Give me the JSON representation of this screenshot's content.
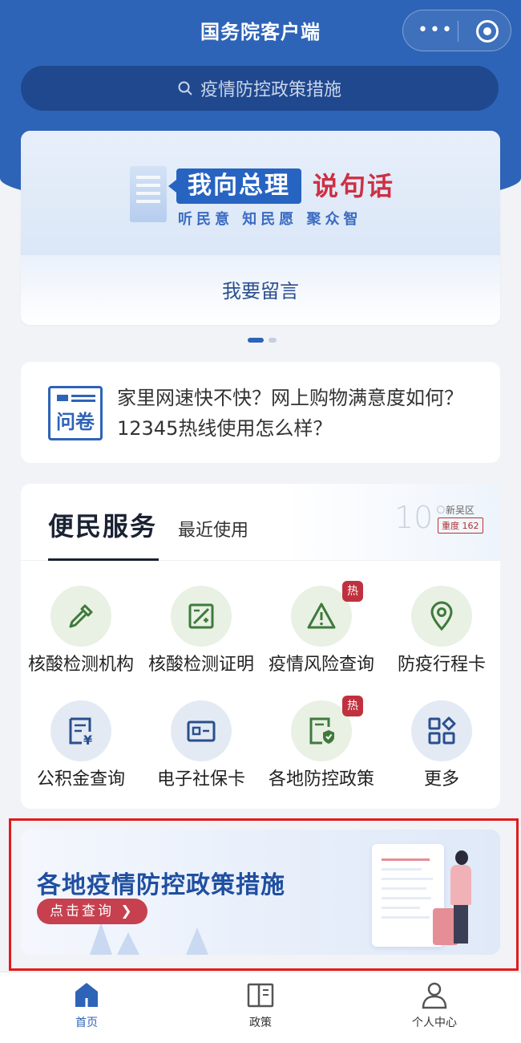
{
  "app": {
    "title": "国务院客户端"
  },
  "search": {
    "placeholder": "疫情防控政策措施"
  },
  "banner": {
    "slogan_main": "我向总理",
    "slogan_accent": "说句话",
    "slogan_sub": "听民意 知民愿 聚众智",
    "action_label": "我要留言"
  },
  "survey": {
    "icon_label": "问卷",
    "text": "家里网速快不快？网上购物满意度如何？12345热线使用怎么样？"
  },
  "services": {
    "tab_active": "便民服务",
    "tab_recent": "最近使用",
    "weather": {
      "temperature": "10°",
      "district": "新吴区",
      "aqi": "重度 162"
    },
    "hot_badge": "热",
    "items": [
      {
        "label": "核酸检测机构",
        "icon": "dropper-icon",
        "hot": false
      },
      {
        "label": "核酸检测证明",
        "icon": "certificate-icon",
        "hot": false
      },
      {
        "label": "疫情风险查询",
        "icon": "warning-icon",
        "hot": true
      },
      {
        "label": "防疫行程卡",
        "icon": "location-pin-icon",
        "hot": false
      },
      {
        "label": "公积金查询",
        "icon": "fund-document-icon",
        "hot": false
      },
      {
        "label": "电子社保卡",
        "icon": "id-card-icon",
        "hot": false
      },
      {
        "label": "各地防控政策",
        "icon": "shield-document-icon",
        "hot": true
      },
      {
        "label": "更多",
        "icon": "grid-more-icon",
        "hot": false
      }
    ]
  },
  "promo": {
    "title": "各地疫情防控政策措施",
    "button": "点击查询 ❯"
  },
  "tabbar": {
    "items": [
      {
        "label": "首页",
        "icon": "home-icon",
        "active": true
      },
      {
        "label": "政策",
        "icon": "book-icon",
        "active": false
      },
      {
        "label": "个人中心",
        "icon": "user-icon",
        "active": false
      }
    ]
  },
  "colors": {
    "primary": "#2e64b7",
    "accent_red": "#cd3043",
    "icon_green": "#3f7a3c",
    "icon_blue": "#2a4f8e",
    "highlight_frame": "#e21b1b"
  }
}
